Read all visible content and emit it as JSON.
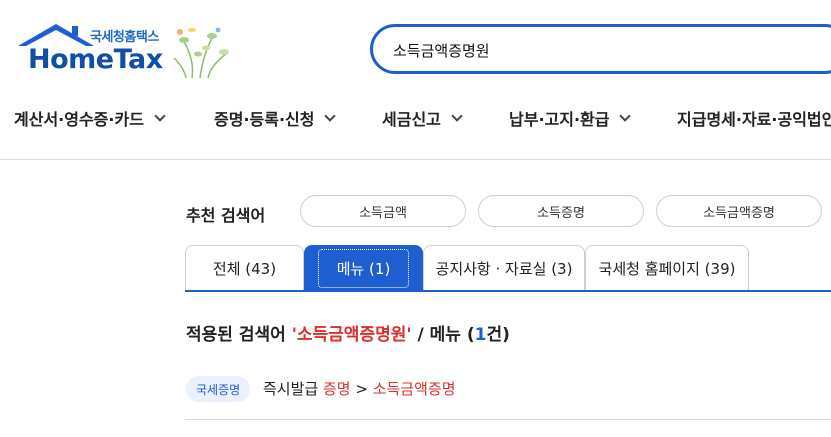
{
  "logo": {
    "korean": "국세청홈택스",
    "english": "HomeTax"
  },
  "search": {
    "value": "소득금액증명원"
  },
  "gnb": [
    {
      "label": "계산서·영수증·카드"
    },
    {
      "label": "증명·등록·신청"
    },
    {
      "label": "세금신고"
    },
    {
      "label": "납부·고지·환급"
    },
    {
      "label": "지급명세·자료·공익법인"
    }
  ],
  "recommended": {
    "title": "추천 검색어",
    "chips": [
      "소득금액",
      "소득증명",
      "소득금액증명"
    ]
  },
  "tabs": [
    {
      "label": "전체 (43)",
      "active": false
    },
    {
      "label": "메뉴 (1)",
      "active": true
    },
    {
      "label": "공지사항 · 자료실 (3)",
      "active": false
    },
    {
      "label": "국세청 홈페이지 (39)",
      "active": false
    }
  ],
  "applied": {
    "prefix": "적용된 검색어 ",
    "keyword": "'소득금액증명원'",
    "middle": " / 메뉴 (",
    "count": "1",
    "suffix": "건)"
  },
  "result": {
    "badge": "국세증명",
    "path_start": "즉시발급 ",
    "path_mid": "증명",
    "separator": " > ",
    "path_end": "소득금액증명"
  },
  "colors": {
    "primary": "#1f5ed0",
    "highlight": "#d9302c",
    "badge_bg": "#e8f1fc"
  }
}
